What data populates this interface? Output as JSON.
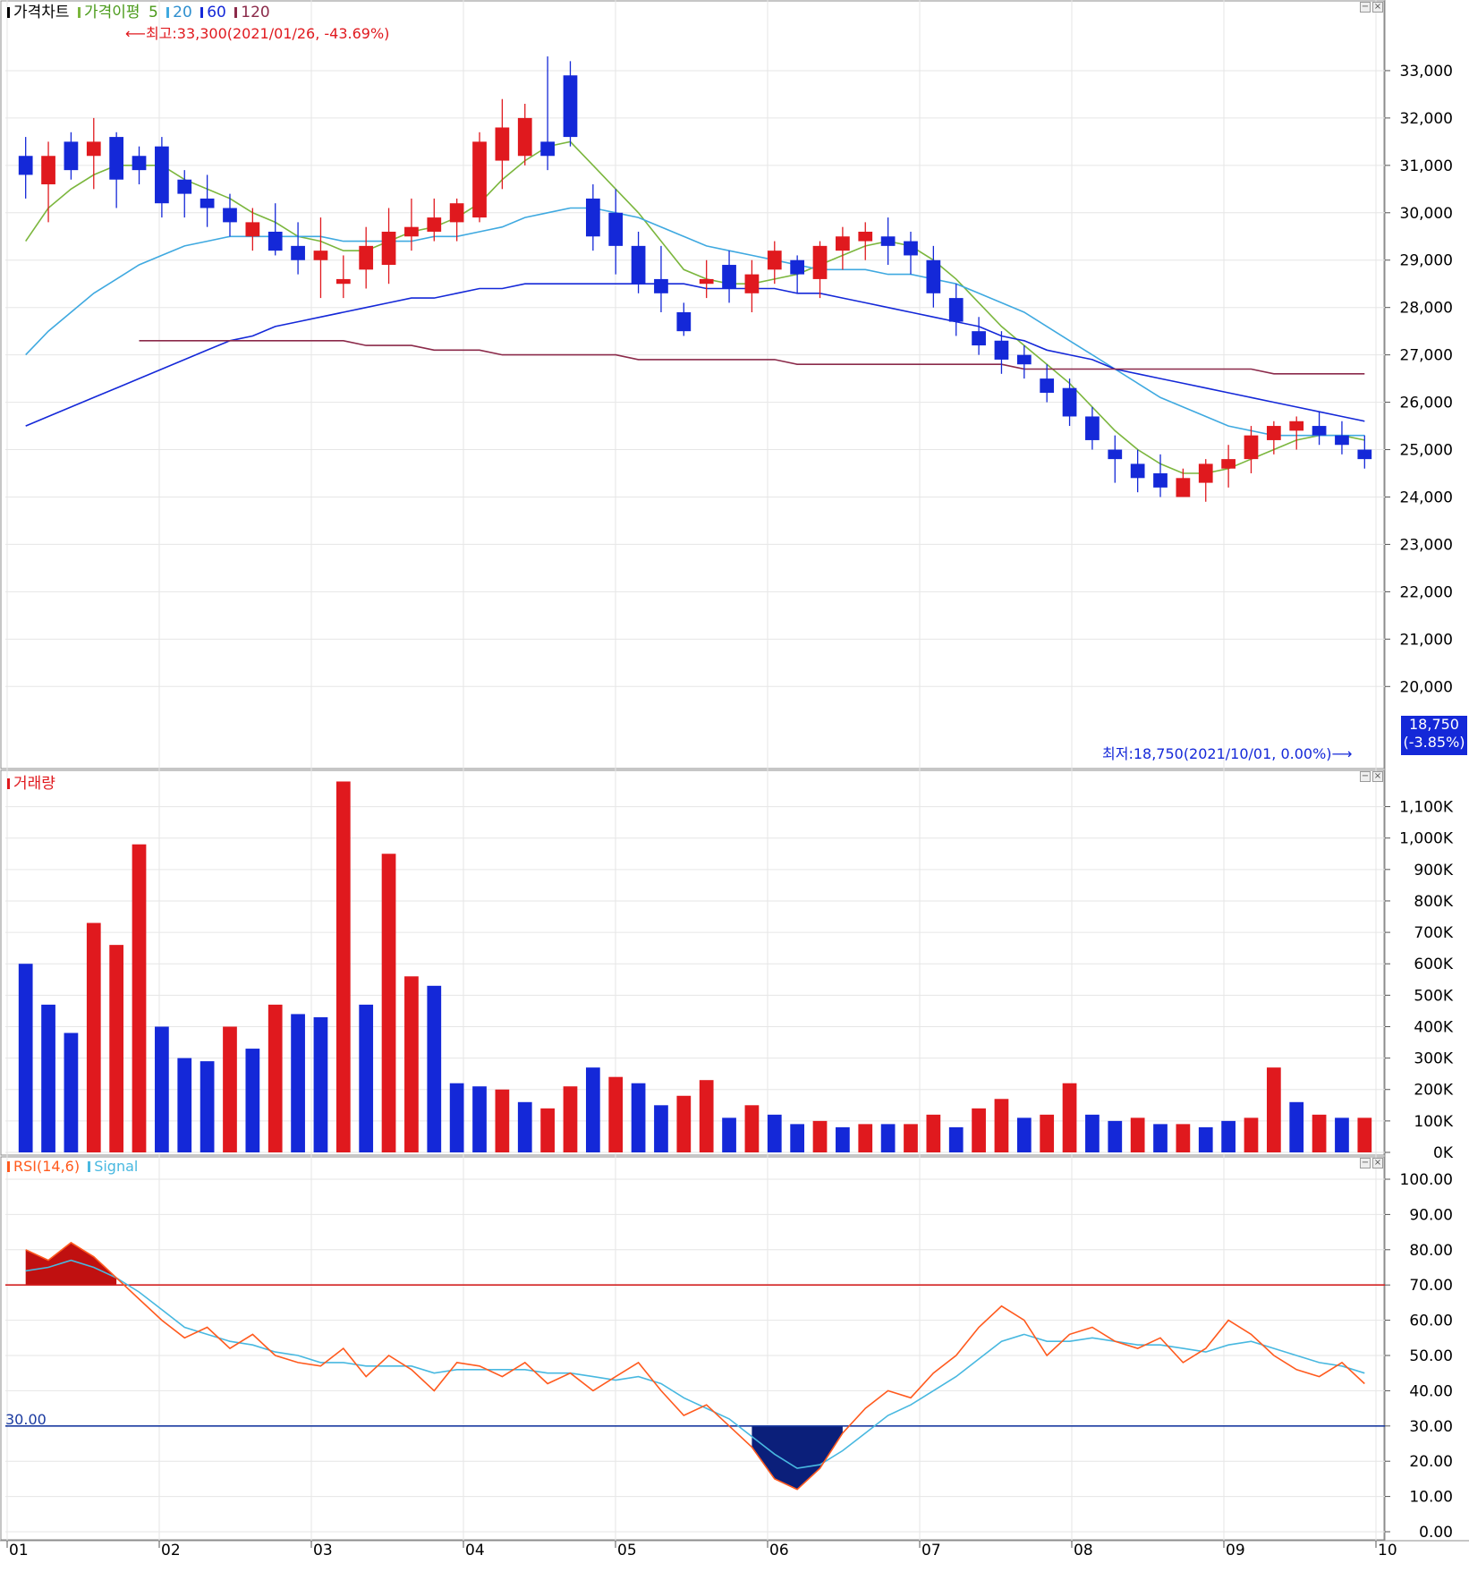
{
  "panels": {
    "price": {
      "title": "가격차트",
      "ma_title": "가격이평",
      "ma_periods": [
        "5",
        "20",
        "60",
        "120"
      ],
      "ma_colors": {
        "5": "#7bb63d",
        "20": "#3fa9e0",
        "60": "#1428d8",
        "120": "#8b2a4a"
      }
    },
    "volume": {
      "title": "거래량"
    },
    "rsi": {
      "title": "RSI(14,6)",
      "signal_title": "Signal"
    }
  },
  "annotations": {
    "high": "최고:33,300(2021/01/26, -43.69%)",
    "low": "최저:18,750(2021/10/01, 0.00%)",
    "last_price": "18,750",
    "last_change": "(-3.85%)"
  },
  "colors": {
    "up": "#e0191e",
    "down": "#1428d8",
    "rsi": "#ff5a1e",
    "signal": "#48b8e0",
    "overbought_line": "#d22222",
    "oversold_line": "#1a3aa0",
    "grid": "#e6e6e6"
  },
  "chart_data": [
    {
      "type": "candlestick",
      "title": "가격차트",
      "x_ticks": [
        "01",
        "02",
        "03",
        "04",
        "05",
        "06",
        "07",
        "08",
        "09",
        "10"
      ],
      "y_ticks": [
        "33,000",
        "32,000",
        "31,000",
        "30,000",
        "29,000",
        "28,000",
        "27,000",
        "26,000",
        "25,000",
        "24,000",
        "23,000",
        "22,000",
        "21,000",
        "20,000"
      ],
      "ylim": [
        18400,
        34000
      ],
      "ohlc_columns": [
        "open",
        "high",
        "low",
        "close"
      ],
      "candles": [
        [
          31200,
          31600,
          30300,
          30800
        ],
        [
          30600,
          31500,
          29800,
          31200
        ],
        [
          31500,
          31700,
          30700,
          30900
        ],
        [
          31200,
          32000,
          30500,
          31500
        ],
        [
          31600,
          31700,
          30100,
          30700
        ],
        [
          31200,
          31400,
          30600,
          30900
        ],
        [
          31400,
          31600,
          29900,
          30200
        ],
        [
          30700,
          30900,
          29900,
          30400
        ],
        [
          30300,
          30800,
          29700,
          30100
        ],
        [
          30100,
          30400,
          29500,
          29800
        ],
        [
          29500,
          30100,
          29200,
          29800
        ],
        [
          29600,
          30200,
          29100,
          29200
        ],
        [
          29300,
          29800,
          28700,
          29000
        ],
        [
          29000,
          29900,
          28200,
          29200
        ],
        [
          28500,
          29100,
          28200,
          28600
        ],
        [
          28800,
          29700,
          28400,
          29300
        ],
        [
          28900,
          30100,
          28500,
          29600
        ],
        [
          29500,
          30300,
          29200,
          29700
        ],
        [
          29600,
          30300,
          29400,
          29900
        ],
        [
          29800,
          30300,
          29400,
          30200
        ],
        [
          29900,
          31700,
          29800,
          31500
        ],
        [
          31100,
          32400,
          30500,
          31800
        ],
        [
          31200,
          32300,
          31000,
          32000
        ],
        [
          31500,
          33300,
          30900,
          31200
        ],
        [
          32900,
          33200,
          31400,
          31600
        ],
        [
          30300,
          30600,
          29200,
          29500
        ],
        [
          30000,
          30500,
          28700,
          29300
        ],
        [
          29300,
          29600,
          28300,
          28500
        ],
        [
          28600,
          29300,
          27900,
          28300
        ],
        [
          27900,
          28100,
          27400,
          27500
        ],
        [
          28500,
          29000,
          28200,
          28600
        ],
        [
          28900,
          29200,
          28100,
          28400
        ],
        [
          28300,
          29000,
          27900,
          28700
        ],
        [
          28800,
          29400,
          28500,
          29200
        ],
        [
          29000,
          29100,
          28300,
          28700
        ],
        [
          28600,
          29400,
          28200,
          29300
        ],
        [
          29200,
          29700,
          28800,
          29500
        ],
        [
          29400,
          29800,
          29000,
          29600
        ],
        [
          29500,
          29900,
          28900,
          29300
        ],
        [
          29400,
          29600,
          28700,
          29100
        ],
        [
          29000,
          29300,
          28000,
          28300
        ],
        [
          28200,
          28500,
          27400,
          27700
        ],
        [
          27500,
          27800,
          27000,
          27200
        ],
        [
          27300,
          27500,
          26600,
          26900
        ],
        [
          27000,
          27200,
          26500,
          26800
        ],
        [
          26500,
          26800,
          26000,
          26200
        ],
        [
          26300,
          26500,
          25500,
          25700
        ],
        [
          25700,
          25900,
          25000,
          25200
        ],
        [
          25000,
          25300,
          24300,
          24800
        ],
        [
          24700,
          25000,
          24100,
          24400
        ],
        [
          24500,
          24900,
          24000,
          24200
        ],
        [
          24000,
          24600,
          24000,
          24400
        ],
        [
          24300,
          24800,
          23900,
          24700
        ],
        [
          24600,
          25100,
          24200,
          24800
        ],
        [
          24800,
          25500,
          24500,
          25300
        ],
        [
          25200,
          25600,
          24900,
          25500
        ],
        [
          25400,
          25700,
          25000,
          25600
        ],
        [
          25500,
          25800,
          25100,
          25300
        ],
        [
          25300,
          25600,
          24900,
          25100
        ],
        [
          25000,
          25300,
          24600,
          24800
        ]
      ],
      "ma_lines": [
        {
          "name": "5",
          "x_start_index": 0,
          "values": [
            29400,
            30100,
            30500,
            30800,
            31000,
            31000,
            31000,
            30700,
            30500,
            30300,
            30000,
            29800,
            29500,
            29400,
            29200,
            29200,
            29400,
            29600,
            29700,
            29900,
            30200,
            30700,
            31100,
            31400,
            31500,
            31000,
            30500,
            30000,
            29400,
            28800,
            28600,
            28500,
            28500,
            28600,
            28700,
            28900,
            29100,
            29300,
            29400,
            29300,
            29000,
            28600,
            28100,
            27600,
            27200,
            26800,
            26400,
            25900,
            25400,
            25000,
            24700,
            24500,
            24500,
            24600,
            24800,
            25000,
            25200,
            25300,
            25300,
            25200
          ]
        },
        {
          "name": "20",
          "x_start_index": 0,
          "values": [
            27000,
            27500,
            27900,
            28300,
            28600,
            28900,
            29100,
            29300,
            29400,
            29500,
            29500,
            29500,
            29500,
            29500,
            29400,
            29400,
            29400,
            29400,
            29500,
            29500,
            29600,
            29700,
            29900,
            30000,
            30100,
            30100,
            30000,
            29900,
            29700,
            29500,
            29300,
            29200,
            29100,
            29000,
            28900,
            28800,
            28800,
            28800,
            28700,
            28700,
            28600,
            28500,
            28300,
            28100,
            27900,
            27600,
            27300,
            27000,
            26700,
            26400,
            26100,
            25900,
            25700,
            25500,
            25400,
            25300,
            25300,
            25300,
            25300,
            25300
          ]
        },
        {
          "name": "60",
          "x_start_index": 0,
          "values": [
            25500,
            25700,
            25900,
            26100,
            26300,
            26500,
            26700,
            26900,
            27100,
            27300,
            27400,
            27600,
            27700,
            27800,
            27900,
            28000,
            28100,
            28200,
            28200,
            28300,
            28400,
            28400,
            28500,
            28500,
            28500,
            28500,
            28500,
            28500,
            28500,
            28500,
            28400,
            28400,
            28400,
            28400,
            28300,
            28300,
            28200,
            28100,
            28000,
            27900,
            27800,
            27700,
            27600,
            27400,
            27300,
            27100,
            27000,
            26900,
            26700,
            26600,
            26500,
            26400,
            26300,
            26200,
            26100,
            26000,
            25900,
            25800,
            25700,
            25600
          ]
        },
        {
          "name": "120",
          "x_start_index": 5,
          "values": [
            27300,
            27300,
            27300,
            27300,
            27300,
            27300,
            27300,
            27300,
            27300,
            27300,
            27200,
            27200,
            27200,
            27100,
            27100,
            27100,
            27000,
            27000,
            27000,
            27000,
            27000,
            27000,
            26900,
            26900,
            26900,
            26900,
            26900,
            26900,
            26900,
            26800,
            26800,
            26800,
            26800,
            26800,
            26800,
            26800,
            26800,
            26800,
            26800,
            26700,
            26700,
            26700,
            26700,
            26700,
            26700,
            26700,
            26700,
            26700,
            26700,
            26700,
            26600,
            26600,
            26600,
            26600,
            26600
          ]
        }
      ]
    },
    {
      "type": "bar",
      "title": "거래량",
      "y_ticks": [
        "1,100K",
        "1,000K",
        "900K",
        "800K",
        "700K",
        "600K",
        "500K",
        "400K",
        "300K",
        "200K",
        "100K",
        "0K"
      ],
      "ylim": [
        0,
        1150
      ],
      "unit": "K",
      "values": [
        600,
        470,
        380,
        730,
        660,
        980,
        400,
        300,
        290,
        400,
        330,
        470,
        440,
        430,
        1180,
        470,
        950,
        560,
        530,
        220,
        210,
        200,
        160,
        140,
        210,
        270,
        240,
        220,
        150,
        180,
        230,
        110,
        150,
        120,
        90,
        100,
        80,
        90,
        90,
        90,
        120,
        80,
        140,
        170,
        110,
        120,
        220,
        120,
        100,
        110,
        90,
        90,
        80,
        100,
        110,
        270,
        160,
        120,
        110,
        110
      ],
      "up": [
        0,
        0,
        0,
        1,
        1,
        1,
        0,
        0,
        0,
        1,
        0,
        1,
        0,
        0,
        1,
        0,
        1,
        1,
        0,
        0,
        0,
        1,
        0,
        1,
        1,
        0,
        1,
        0,
        0,
        1,
        1,
        0,
        1,
        0,
        0,
        1,
        0,
        1,
        0,
        1,
        1,
        0,
        1,
        1,
        0,
        1,
        1,
        0,
        0,
        1,
        0,
        1,
        0,
        0,
        1,
        1,
        0,
        1,
        0,
        1
      ]
    },
    {
      "type": "line",
      "title": "RSI(14,6)",
      "y_ticks": [
        "100.00",
        "90.00",
        "80.00",
        "70.00",
        "60.00",
        "50.00",
        "40.00",
        "30.00",
        "20.00",
        "10.00",
        "0.00"
      ],
      "ylim": [
        0,
        100
      ],
      "reference_lines": [
        70,
        30
      ],
      "reference_label": "30.00",
      "series": [
        {
          "name": "RSI(14,6)",
          "values": [
            80,
            77,
            82,
            78,
            72,
            66,
            60,
            55,
            58,
            52,
            56,
            50,
            48,
            47,
            52,
            44,
            50,
            46,
            40,
            48,
            47,
            44,
            48,
            42,
            45,
            40,
            44,
            48,
            40,
            33,
            36,
            30,
            24,
            15,
            12,
            18,
            28,
            35,
            40,
            38,
            45,
            50,
            58,
            64,
            60,
            50,
            56,
            58,
            54,
            52,
            55,
            48,
            52,
            60,
            56,
            50,
            46,
            44,
            48,
            42
          ]
        },
        {
          "name": "Signal",
          "values": [
            74,
            75,
            77,
            75,
            72,
            68,
            63,
            58,
            56,
            54,
            53,
            51,
            50,
            48,
            48,
            47,
            47,
            47,
            45,
            46,
            46,
            46,
            46,
            45,
            45,
            44,
            43,
            44,
            42,
            38,
            35,
            32,
            27,
            22,
            18,
            19,
            23,
            28,
            33,
            36,
            40,
            44,
            49,
            54,
            56,
            54,
            54,
            55,
            54,
            53,
            53,
            52,
            51,
            53,
            54,
            52,
            50,
            48,
            47,
            45
          ]
        }
      ]
    }
  ]
}
